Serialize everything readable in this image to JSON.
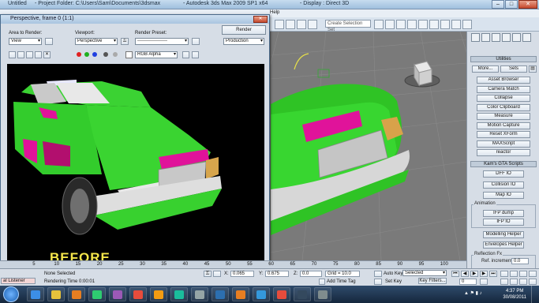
{
  "app": {
    "title_left": "Untitled",
    "title_project": "- Project Folder: C:\\Users\\Sam\\Documents\\3dsmax",
    "title_main": "- Autodesk 3ds Max  2009 SP1  x64",
    "title_right": "- Display : Direct 3D",
    "help_menu": "Help"
  },
  "toolbar": {
    "selection_set_placeholder": "Create Selection Set"
  },
  "render_frame": {
    "title": "Perspective, frame 0 (1:1)",
    "area_label": "Area to Render:",
    "area_value": "View",
    "viewport_label": "Viewport:",
    "viewport_value": "Perspective",
    "preset_label": "Render Preset:",
    "preset_value": "-------------------",
    "render_button": "Render",
    "production_value": "Production",
    "channel_value": "RGB Alpha",
    "overlay_text": "BEFORE"
  },
  "command_panel": {
    "utilities_header": "Utilities",
    "more_button": "More...",
    "sets_button": "Sets",
    "utility_buttons": [
      "Asset Browser",
      "Camera Match",
      "Collapse",
      "Color Clipboard",
      "Measure",
      "Motion Capture",
      "Reset XForm",
      "MAXScript",
      "reactor"
    ],
    "kams_header": "Kam's GTA Scripts",
    "kams_buttons": [
      "DFF IO",
      "Collision IO",
      "Map IO"
    ],
    "animation_label": "Animation",
    "animation_buttons": [
      "IFP dump",
      "IFP IO"
    ],
    "modelling_button": "Modelling Helper",
    "envelopes_button": "Envelopes Helper",
    "reflection_label": "Reflection Fx",
    "ref_increment_label": "Ref. increment",
    "ref_increment_value": "0.0"
  },
  "status": {
    "listener": "al Listener",
    "selection": "None Selected",
    "render_time": "Rendering Time 0:00:01",
    "x_label": "X:",
    "x_value": "0.065",
    "y_label": "Y:",
    "y_value": "0.675",
    "z_label": "Z:",
    "z_value": "0.0",
    "grid": "Grid = 10.0",
    "add_time_tag": "Add Time Tag",
    "auto_key": "Auto Key",
    "auto_key_value": "Selected",
    "set_key": "Set Key",
    "key_filters": "Key Filters...",
    "frame_value": "0"
  },
  "timeline": {
    "ticks": [
      "5",
      "10",
      "15",
      "20",
      "25",
      "30",
      "35",
      "40",
      "45",
      "50",
      "55",
      "60",
      "65",
      "70",
      "75",
      "80",
      "85",
      "90",
      "95",
      "100"
    ]
  },
  "taskbar": {
    "time": "4:37 PM",
    "date": "30/08/2011"
  },
  "colors": {
    "car_green": "#32d12a",
    "car_magenta": "#e0139a",
    "titlebar": "#a9c4df",
    "beforeText": "#f5e64a"
  }
}
